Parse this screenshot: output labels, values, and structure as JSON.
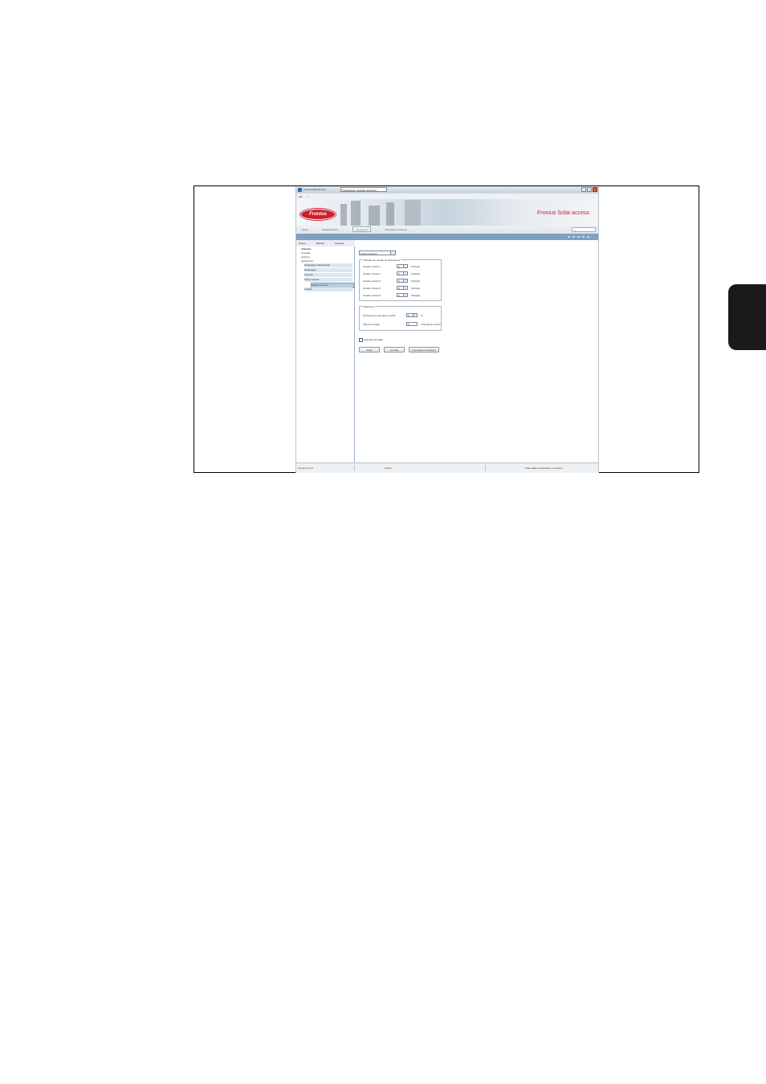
{
  "window": {
    "title": "Fronius Solar.access",
    "document_tab": "Impostazioni: centrale (esempio)",
    "controls": [
      "_",
      "□",
      "×"
    ]
  },
  "menu": {
    "items": [
      "File",
      "?"
    ]
  },
  "banner": {
    "logo_text": "Fronius",
    "brand_text": "Fronius Solar.access"
  },
  "nav": {
    "tabs": [
      "Setup",
      "Visualizzazione",
      "Impostazioni",
      "Informazioni sistema"
    ],
    "active_index": 2,
    "language": "it"
  },
  "toolbar": {
    "items": [
      "Nuovo",
      "Elimina",
      "Accesso"
    ]
  },
  "tree": {
    "items": [
      {
        "label": "Impianto",
        "level": 0,
        "bold": true
      },
      {
        "label": "Centrale",
        "level": 0
      },
      {
        "label": "Archivio",
        "level": 0
      },
      {
        "label": "Apparecchi",
        "level": 0
      },
      {
        "label": "Datalogger dell'impianto",
        "level": 1
      },
      {
        "label": "Datalogger",
        "level": 1
      },
      {
        "label": "Sensore",
        "level": 1
      },
      {
        "label": "String Control",
        "level": 1
      },
      {
        "label": "String Control 1",
        "level": 2,
        "selected": true
      },
      {
        "label": "Inverter",
        "level": 1
      }
    ]
  },
  "content": {
    "device_select": "String Control 1",
    "group_strings": {
      "title": "Stringhe per canale di misurazione",
      "rows": [
        {
          "label": "Canale misura 1:",
          "value": "0",
          "unit": "Stringhe"
        },
        {
          "label": "Canale misura 2:",
          "value": "0",
          "unit": "Stringhe"
        },
        {
          "label": "Canale misura 3:",
          "value": "0",
          "unit": "Stringhe"
        },
        {
          "label": "Canale misura 4:",
          "value": "0",
          "unit": "Stringhe"
        },
        {
          "label": "Canale misura 5:",
          "value": "0",
          "unit": "Stringhe"
        }
      ]
    },
    "group_limits": {
      "title": "Tolleranze",
      "rows": [
        {
          "label": "Scostamento dal valore medio:",
          "value": "0",
          "unit": "%"
        },
        {
          "label": "Valore di soglia:",
          "value": "0",
          "unit": "A/canale di misura"
        }
      ]
    },
    "checkbox_label": "Segnala anomalie",
    "checkbox_checked": true,
    "buttons": [
      "Salva",
      "Annulla",
      "Impostazioni standard"
    ]
  },
  "statusbar": {
    "left": "Versione 2.0.1",
    "middle": "Pronto",
    "right": "Stato della connessione: connesso"
  }
}
